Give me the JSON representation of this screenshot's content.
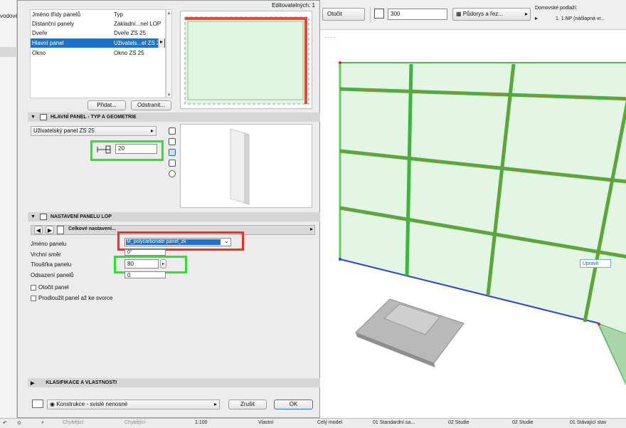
{
  "left_strip": {
    "cut_label": "vodovél"
  },
  "dialog": {
    "top_counter": "Editovatelných: 1",
    "panel_list": {
      "col1_header": "Jméno třídy panelů",
      "col2_header": "Typ",
      "rows": [
        {
          "name": "Distanční panely",
          "type": "Základní...nel LOP"
        },
        {
          "name": "Dveře",
          "type": "Dveře ZS 25"
        },
        {
          "name": "Hlavní panel",
          "type": "Uživatels...el ZS 25"
        },
        {
          "name": "Okno",
          "type": "Okno ZS 25"
        }
      ]
    },
    "add_button": "Přidat...",
    "remove_button": "Odstranit...",
    "section_geometry": "HLAVNÍ PANEL - TYP A GEOMETRIE",
    "panel_type_dropdown": "Uživatelský panel ZS 25",
    "frame_offset_value": "20",
    "section_lop": "NASTAVENÍ PANELU LOP",
    "nav_dropdown": "Celkové nastavení...",
    "fields": {
      "panel_name_label": "Jméno panelu",
      "panel_name_value": "M_polycarbonate panel_zk",
      "top_direction_label": "Vrchní směr",
      "top_direction_value": "0°",
      "thickness_label": "Tloušťka panelu",
      "thickness_value": "80",
      "offset_label": "Odsazení panelů",
      "offset_value": "0",
      "rotate_label": "Otočit panel",
      "extend_label": "Prodloužit panel až ke svorce"
    },
    "section_classification": "KLASIFIKACE A VLASTNOSTI",
    "footer_dropdown": "Konstrukce - svislé nenosné",
    "cancel_button": "Zrušit",
    "ok_button": "OK"
  },
  "toolbar": {
    "rotate_button": "Otočit",
    "value_300": "300",
    "view_dropdown": "Půdorys a řez...",
    "home_story_label": "Domovské podlaží:",
    "home_story_value": "1. 1.NP (nášlapná vr..."
  },
  "view3d": {
    "edit_tooltip": "Upravit",
    "dashes": "- - - -"
  },
  "statusbar": {
    "missing1": "Chybějící",
    "missing2": "Chybějící",
    "scale": "1:100",
    "own": "Vlastní",
    "whole_model": "Celý model",
    "std_set": "01 Standardní sa...",
    "study1": "02 Studie",
    "study2": "02 Studie",
    "existing": "01 Stávající stav"
  },
  "colors": {
    "highlight_green": "#27e627",
    "highlight_red": "#ff2a1a",
    "selection_blue": "#1e73c8"
  }
}
